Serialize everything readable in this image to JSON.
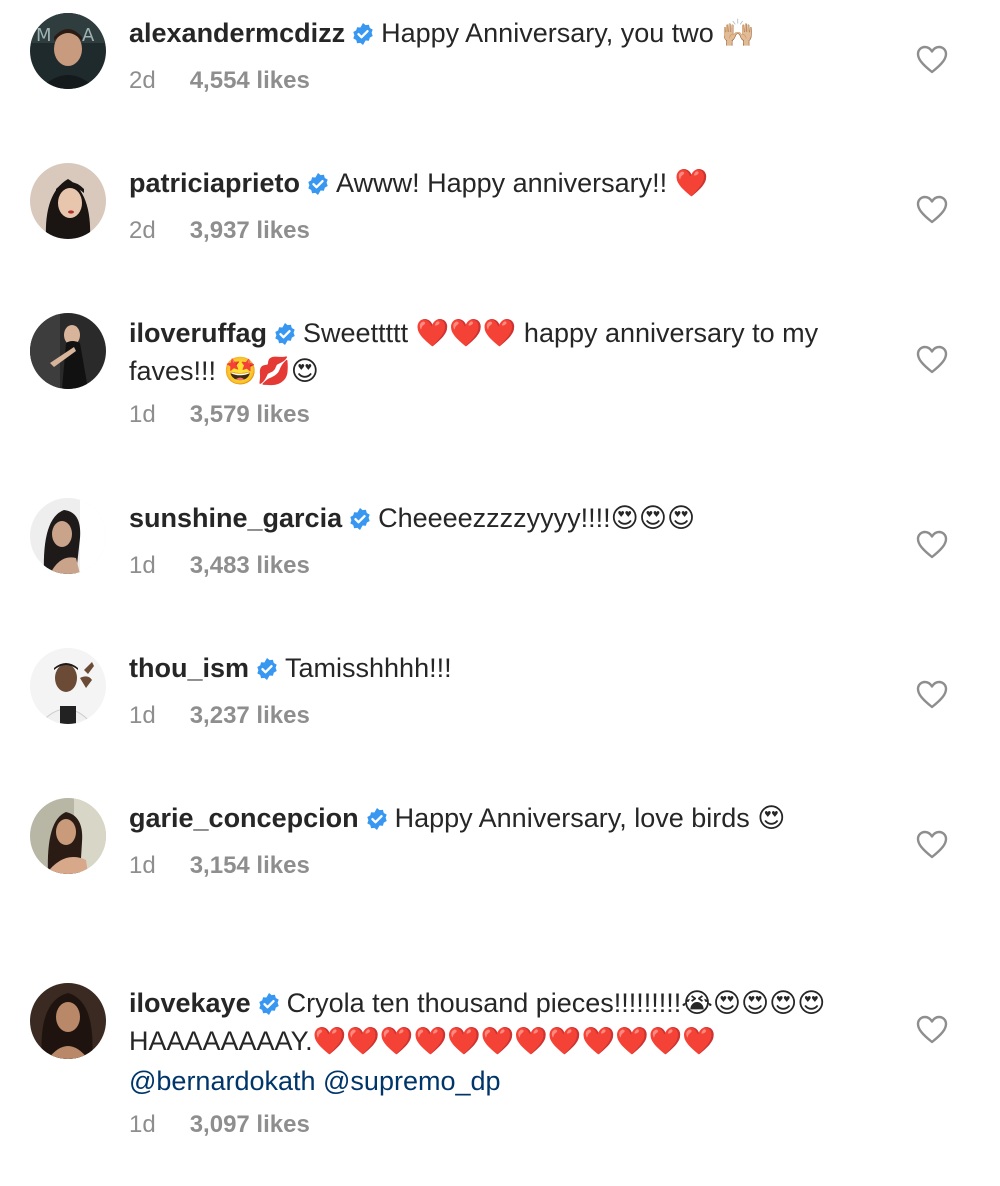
{
  "comments": [
    {
      "username": "alexandermcdizz",
      "text": "Happy Anniversary, you two 🙌🏼",
      "mentions": "",
      "time": "2d",
      "likes": "4,554 likes",
      "avatar_icon": "avatar-alexandermcdizz"
    },
    {
      "username": "patriciaprieto",
      "text": "Awww! Happy anniversary!! ❤️",
      "mentions": "",
      "time": "2d",
      "likes": "3,937 likes",
      "avatar_icon": "avatar-patriciaprieto"
    },
    {
      "username": "iloveruffag",
      "text": "Sweettttt ❤️❤️❤️ happy anniversary to my faves!!! 🤩💋😍",
      "mentions": "",
      "time": "1d",
      "likes": "3,579 likes",
      "avatar_icon": "avatar-iloveruffag"
    },
    {
      "username": "sunshine_garcia",
      "text": "Cheeeezzzzyyyy!!!!😍😍😍",
      "mentions": "",
      "time": "1d",
      "likes": "3,483 likes",
      "avatar_icon": "avatar-sunshine_garcia"
    },
    {
      "username": "thou_ism",
      "text": "Tamisshhhh!!!",
      "mentions": "",
      "time": "1d",
      "likes": "3,237 likes",
      "avatar_icon": "avatar-thou_ism"
    },
    {
      "username": "garie_concepcion",
      "text": "Happy Anniversary, love birds 😍",
      "mentions": "",
      "time": "1d",
      "likes": "3,154 likes",
      "avatar_icon": "avatar-garie_concepcion"
    },
    {
      "username": "ilovekaye",
      "text": "Cryola ten thousand pieces!!!!!!!!!😭😍😍😍😍 HAAAAAAAAY.❤️❤️❤️❤️❤️❤️❤️❤️❤️❤️❤️❤️",
      "mentions": "@bernardokath @supremo_dp",
      "time": "1d",
      "likes": "3,097 likes",
      "avatar_icon": "avatar-ilovekaye"
    }
  ],
  "colors": {
    "username": "#262626",
    "meta": "#8e8e8e",
    "verified": "#3897f0",
    "mention": "#003569",
    "heart_outline": "#8e8e8e"
  }
}
